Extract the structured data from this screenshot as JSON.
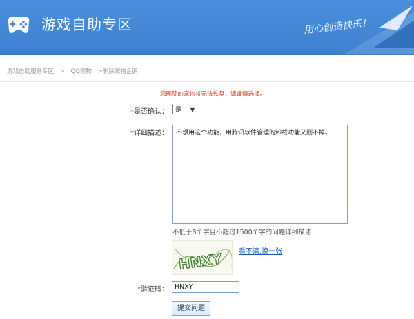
{
  "header": {
    "title": "游戏自助专区",
    "slogan": "用心创造快乐！"
  },
  "breadcrumb": [
    "游戏自助服务专区",
    ">",
    "QQ宠物",
    ">删除宠物企鹅"
  ],
  "warning": "您删除的宠物将无法恢复，请谨慎选择。",
  "form": {
    "confirm_label": "是否确认：",
    "confirm_value": "是",
    "detail_label": "详细描述：",
    "detail_value": "不想用这个功能，用腾讯软件管理的卸载功能又删不掉。",
    "hint": "不低于8个字且不超过1500个字的问题详细描述",
    "captcha_text": "HNXY",
    "refresh_link": "看不清,换一张",
    "code_label": "验证码：",
    "code_value": "HNXY",
    "submit_label": "提交问题",
    "required_mark": "*"
  },
  "colors": {
    "header_bg": "#3d84d4",
    "warning": "#d83a1c",
    "link": "#1a56b8"
  },
  "icons": {
    "logo": "gamepad-icon",
    "select_caret": "caret-down-icon"
  }
}
